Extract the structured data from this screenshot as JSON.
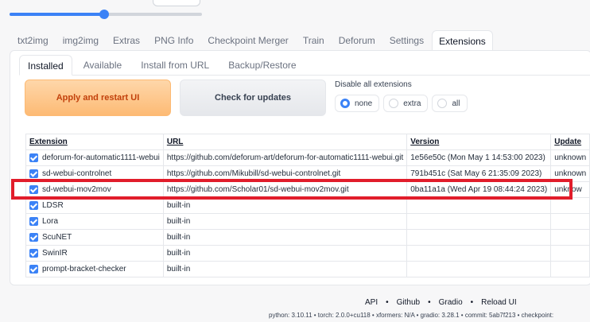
{
  "slider": {
    "value_fraction": 0.49
  },
  "main_tabs": [
    "txt2img",
    "img2img",
    "Extras",
    "PNG Info",
    "Checkpoint Merger",
    "Train",
    "Deforum",
    "Settings",
    "Extensions"
  ],
  "sub_tabs": [
    "Installed",
    "Available",
    "Install from URL",
    "Backup/Restore"
  ],
  "buttons": {
    "apply": "Apply and restart UI",
    "check": "Check for updates"
  },
  "disable": {
    "label": "Disable all extensions",
    "options": [
      "none",
      "extra",
      "all"
    ],
    "selected": "none"
  },
  "table": {
    "headers": [
      "Extension",
      "URL",
      "Version",
      "Update"
    ],
    "rows": [
      {
        "name": "deforum-for-automatic1111-webui",
        "url": "https://github.com/deforum-art/deforum-for-automatic1111-webui.git",
        "version": "1e56e50c (Mon May 1 14:53:00 2023)",
        "update": "unknown"
      },
      {
        "name": "sd-webui-controlnet",
        "url": "https://github.com/Mikubill/sd-webui-controlnet.git",
        "version": "791b451c (Sat May 6 21:35:09 2023)",
        "update": "unknown"
      },
      {
        "name": "sd-webui-mov2mov",
        "url": "https://github.com/Scholar01/sd-webui-mov2mov.git",
        "version": "0ba11a1a (Wed Apr 19 08:44:24 2023)",
        "update": "unknow"
      },
      {
        "name": "LDSR",
        "url": "built-in",
        "version": "",
        "update": ""
      },
      {
        "name": "Lora",
        "url": "built-in",
        "version": "",
        "update": ""
      },
      {
        "name": "ScuNET",
        "url": "built-in",
        "version": "",
        "update": ""
      },
      {
        "name": "SwinIR",
        "url": "built-in",
        "version": "",
        "update": ""
      },
      {
        "name": "prompt-bracket-checker",
        "url": "built-in",
        "version": "",
        "update": ""
      }
    ]
  },
  "footer": {
    "links": [
      "API",
      "Github",
      "Gradio",
      "Reload UI"
    ],
    "separator": "•",
    "info": "python: 3.10.11  •  torch: 2.0.0+cu118  •  xformers: N/A  •  gradio: 3.28.1  •  commit: 5ab7f213  •  checkpoint:"
  },
  "colors": {
    "accent": "#3b82f6",
    "highlight": "#e11d2b",
    "apply_text": "#c2410c"
  }
}
